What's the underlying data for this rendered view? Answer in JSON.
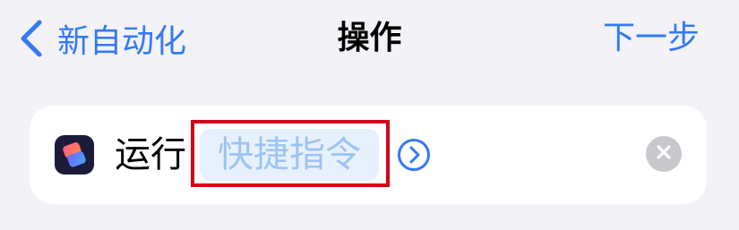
{
  "nav": {
    "back_label": "新自动化",
    "title": "操作",
    "next_label": "下一步"
  },
  "action": {
    "run_label": "运行",
    "shortcut_placeholder": "快捷指令"
  },
  "icons": {
    "back": "chevron-left-icon",
    "app": "shortcuts-app-icon",
    "detail": "chevron-right-circle-icon",
    "clear": "clear-x-icon"
  },
  "colors": {
    "accent": "#3478f6",
    "highlight": "#d0021b",
    "background": "#f2f2f7"
  }
}
